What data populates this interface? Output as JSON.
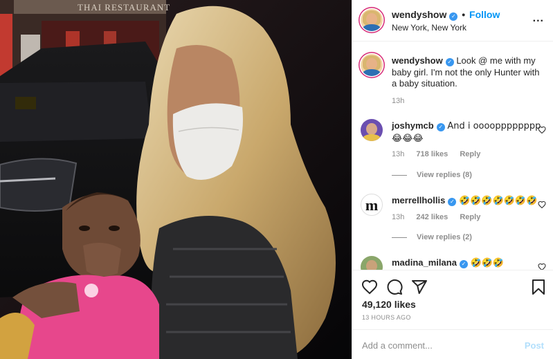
{
  "post": {
    "username": "wendyshow",
    "follow_label": "Follow",
    "dot": "•",
    "location": "New York, New York",
    "more": "...",
    "verified_mark": "✓"
  },
  "photo": {
    "sign_text": "THAI RESTAURANT"
  },
  "comments": [
    {
      "username": "wendyshow",
      "text": "Look @ me with my baby girl. I'm not the only Hunter with a baby situation.",
      "time": "13h",
      "verified": true
    },
    {
      "username": "joshymcb",
      "text": "And i oooopppppppp 😂😂😂",
      "time": "13h",
      "likes": "718 likes",
      "reply": "Reply",
      "view_replies": "View replies (8)",
      "verified": true
    },
    {
      "username": "merrellhollis",
      "text": "🤣🤣🤣🤣🤣🤣🤣",
      "time": "13h",
      "likes": "242 likes",
      "reply": "Reply",
      "view_replies": "View replies (2)",
      "avatar_letter": "m",
      "verified": true
    },
    {
      "username": "madina_milana",
      "text": "🤣🤣🤣",
      "verified": true
    }
  ],
  "actions": {
    "likes": "49,120 likes",
    "time_ago": "13 HOURS AGO"
  },
  "add_comment": {
    "placeholder": "Add a comment...",
    "post_label": "Post"
  },
  "icons": [
    "heart-icon",
    "comment-icon",
    "share-icon",
    "bookmark-icon",
    "more-icon",
    "verified-icon"
  ],
  "colors": {
    "accent": "#0095f6",
    "verified": "#3897f0",
    "muted": "#8e8e8e",
    "post_disabled": "#b2dffc"
  }
}
